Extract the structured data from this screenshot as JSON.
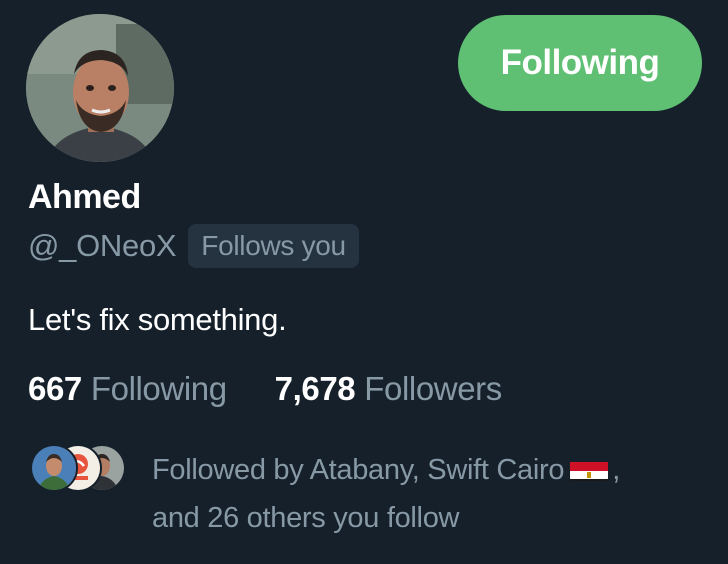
{
  "profile": {
    "name": "Ahmed",
    "handle": "@_ONeoX",
    "follows_you_label": "Follows you",
    "bio": "Let's fix something.",
    "follow_button_label": "Following"
  },
  "stats": {
    "following_count": "667",
    "following_label": "Following",
    "followers_count": "7,678",
    "followers_label": "Followers"
  },
  "followed_by": {
    "text_prefix": "Followed by Atabany, Swift Cairo",
    "flag_icon": "egypt-flag-icon",
    "text_suffix": ",",
    "text_line2": "and 26 others you follow"
  },
  "colors": {
    "background": "#15202b",
    "follow_button": "#5fbf73",
    "secondary_text": "#8899a6",
    "badge_background": "#253341"
  }
}
